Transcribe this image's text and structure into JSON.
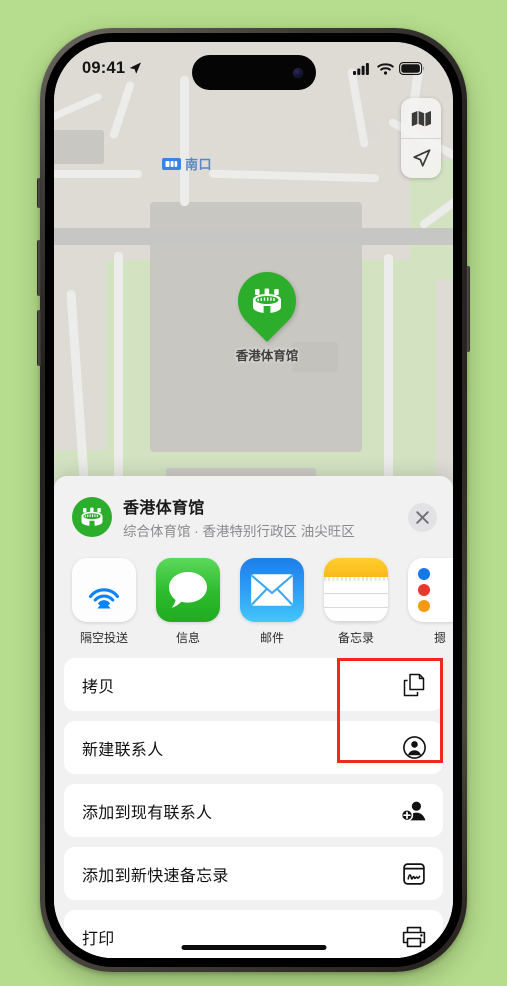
{
  "theme": {
    "wallpaper_green": "#b6dd8d",
    "map_land": "#dedbd5",
    "sheet_bg": "#f1f1f1",
    "accent_green": "#2cad2c",
    "highlight_red": "#f0281e",
    "transit_blue": "#3b82e6"
  },
  "status_bar": {
    "time": "09:41",
    "location_icon": "location-arrow-icon",
    "cellular_icon": "cellular-bars-icon",
    "wifi_icon": "wifi-icon",
    "battery_icon": "battery-full-icon"
  },
  "map": {
    "transit_label": "南口",
    "transit_badge_icon": "subway-badge-icon",
    "poi_label": "香港体育馆",
    "poi_icon": "stadium-icon",
    "controls": [
      {
        "name": "map-type-button",
        "icon": "folded-map-icon"
      },
      {
        "name": "locate-me-button",
        "icon": "location-arrow-icon"
      }
    ]
  },
  "share_sheet": {
    "poi_icon": "stadium-icon",
    "title": "香港体育馆",
    "subtitle": "综合体育馆 · 香港特别行政区 油尖旺区",
    "close_label": "✕",
    "apps": [
      {
        "id": "airdrop",
        "label": "隔空投送",
        "icon": "airdrop-icon"
      },
      {
        "id": "messages",
        "label": "信息",
        "icon": "messages-icon"
      },
      {
        "id": "mail",
        "label": "邮件",
        "icon": "mail-icon"
      },
      {
        "id": "notes",
        "label": "备忘录",
        "icon": "notes-icon",
        "highlighted": true
      },
      {
        "id": "app5",
        "label": "摁",
        "icon": "dots-app-icon"
      }
    ],
    "actions": [
      {
        "id": "copy",
        "label": "拷贝",
        "icon": "copy-documents-icon"
      },
      {
        "id": "new-contact",
        "label": "新建联系人",
        "icon": "person-circle-icon"
      },
      {
        "id": "existing-contact",
        "label": "添加到现有联系人",
        "icon": "person-badge-plus-icon"
      },
      {
        "id": "quick-note",
        "label": "添加到新快速备忘录",
        "icon": "quick-note-icon"
      },
      {
        "id": "print",
        "label": "打印",
        "icon": "printer-icon"
      }
    ]
  }
}
